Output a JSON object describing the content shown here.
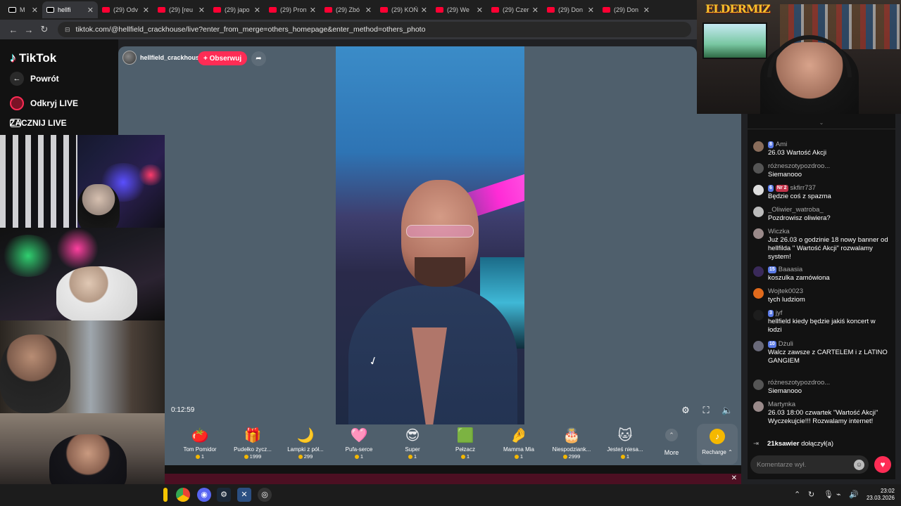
{
  "browser": {
    "tabs": [
      {
        "favicon": "tiktok-icon",
        "title": "M"
      },
      {
        "favicon": "tiktok-icon",
        "title": "hellfi"
      },
      {
        "favicon": "youtube-icon",
        "title": "(29) Odv"
      },
      {
        "favicon": "youtube-icon",
        "title": "(29) [reu"
      },
      {
        "favicon": "youtube-icon",
        "title": "(29) japo"
      },
      {
        "favicon": "youtube-icon",
        "title": "(29) Pron"
      },
      {
        "favicon": "youtube-icon",
        "title": "(29) Zbó"
      },
      {
        "favicon": "youtube-icon",
        "title": "(29) KOŃ"
      },
      {
        "favicon": "youtube-icon",
        "title": "(29) We"
      },
      {
        "favicon": "youtube-icon",
        "title": "(29) Czer"
      },
      {
        "favicon": "youtube-icon",
        "title": "(29) Don"
      },
      {
        "favicon": "youtube-icon",
        "title": "(29) Don"
      }
    ],
    "url": "tiktok.com/@hellfield_crackhouse/live?enter_from_merge=others_homepage&enter_method=others_photo"
  },
  "tiktok_nav": {
    "logo": "TikTok",
    "back": "Powrót",
    "discover": "Odkryj LIVE",
    "go_live": "ZACZNIJ LIVE"
  },
  "stream": {
    "username": "hellfield_crackhouse",
    "follow_label": "+ Obserwuj",
    "elapsed": "0:12:59"
  },
  "gifts": [
    {
      "name": "Tom Pomidor",
      "price": "1",
      "icon": "🍅"
    },
    {
      "name": "Pudełko życz...",
      "price": "1999",
      "icon": "🎁"
    },
    {
      "name": "Lampki z pół...",
      "price": "299",
      "icon": "🌙"
    },
    {
      "name": "Pufa-serce",
      "price": "1",
      "icon": "🩷"
    },
    {
      "name": "Super",
      "price": "1",
      "icon": "😎"
    },
    {
      "name": "Pełzacz",
      "price": "1",
      "icon": "🟩"
    },
    {
      "name": "Mamma Mia",
      "price": "1",
      "icon": "🤌"
    },
    {
      "name": "Niespodziank...",
      "price": "2999",
      "icon": "🎂"
    },
    {
      "name": "Jesteś niesa...",
      "price": "1",
      "icon": "🐱"
    }
  ],
  "gift_more": "More",
  "recharge": "Recharge",
  "overlay_logo": "ELDERMIZ",
  "chat": {
    "messages": [
      {
        "badges": [
          "8"
        ],
        "user": "Ami",
        "text": "26.03 Wartość Akcji"
      },
      {
        "badges": [],
        "user": "różneszotypozdroo...",
        "text": "Siemanooo"
      },
      {
        "badges": [
          "6",
          "Nr 2"
        ],
        "user": "skfirr737",
        "text": "Będzie coś z spazma"
      },
      {
        "badges": [],
        "user": "_Oliwier_watroba_",
        "text": "Pozdrowisz oliwiera?"
      },
      {
        "badges": [],
        "user": "Wiczka",
        "text": "Już 26.03 o godzinie 18 nowy banner od hellfilda \" Wartość Akcji\" rozwalamy system!"
      },
      {
        "badges": [
          "15"
        ],
        "user": "Baaasia",
        "text": "koszulka zamówiona"
      },
      {
        "badges": [],
        "user": "Wojtek0023",
        "text": "tych ludziom"
      },
      {
        "badges": [
          "3"
        ],
        "user": "jyf",
        "text": "hellfield kiedy będzie jakiś koncert w łodzi"
      },
      {
        "badges": [
          "10"
        ],
        "user": "Dżuli",
        "text": "Walcz zawsze z CARTELEM i z LATINO GANGIEM"
      },
      {
        "badges": [],
        "user": "różneszotypozdroo...",
        "text": "Siemanooo"
      },
      {
        "badges": [],
        "user": "Martynka",
        "text": "26.03 18:00 czwartek \"Wartość Akcji\" Wyczekujcie!!! Rozwalamy internet!"
      }
    ],
    "joined_user": "21ksawier",
    "joined_text": "dołączył(a)",
    "comment_placeholder": "Komentarze wył."
  },
  "clock": {
    "time": "23:02",
    "date": "23.03.2026"
  },
  "colors": {
    "accent": "#fe2c55",
    "stage": "#4f5f6c",
    "coin": "#f5b800"
  }
}
